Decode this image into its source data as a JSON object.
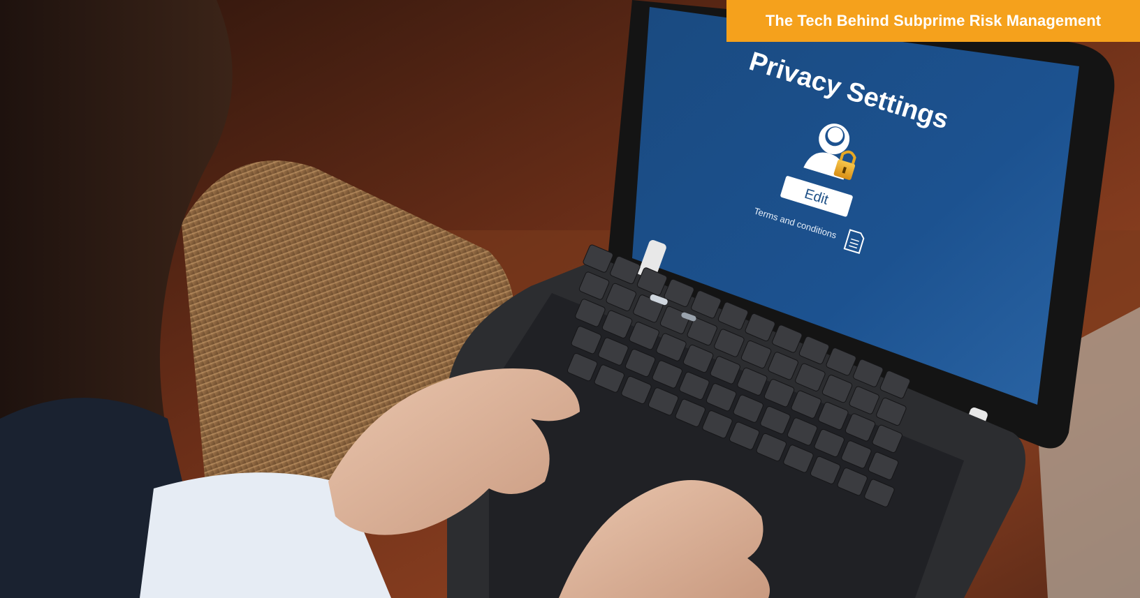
{
  "banner": {
    "title": "The Tech Behind Subprime Risk Management"
  },
  "laptop_screen": {
    "heading": "Privacy Settings",
    "button_label": "Edit",
    "link_text": "Terms and conditions",
    "user_lock_icon": "user-lock-icon",
    "document_icon": "document-icon"
  },
  "colors": {
    "banner": "#f5a11c",
    "screen_blue": "#1c4f86"
  }
}
